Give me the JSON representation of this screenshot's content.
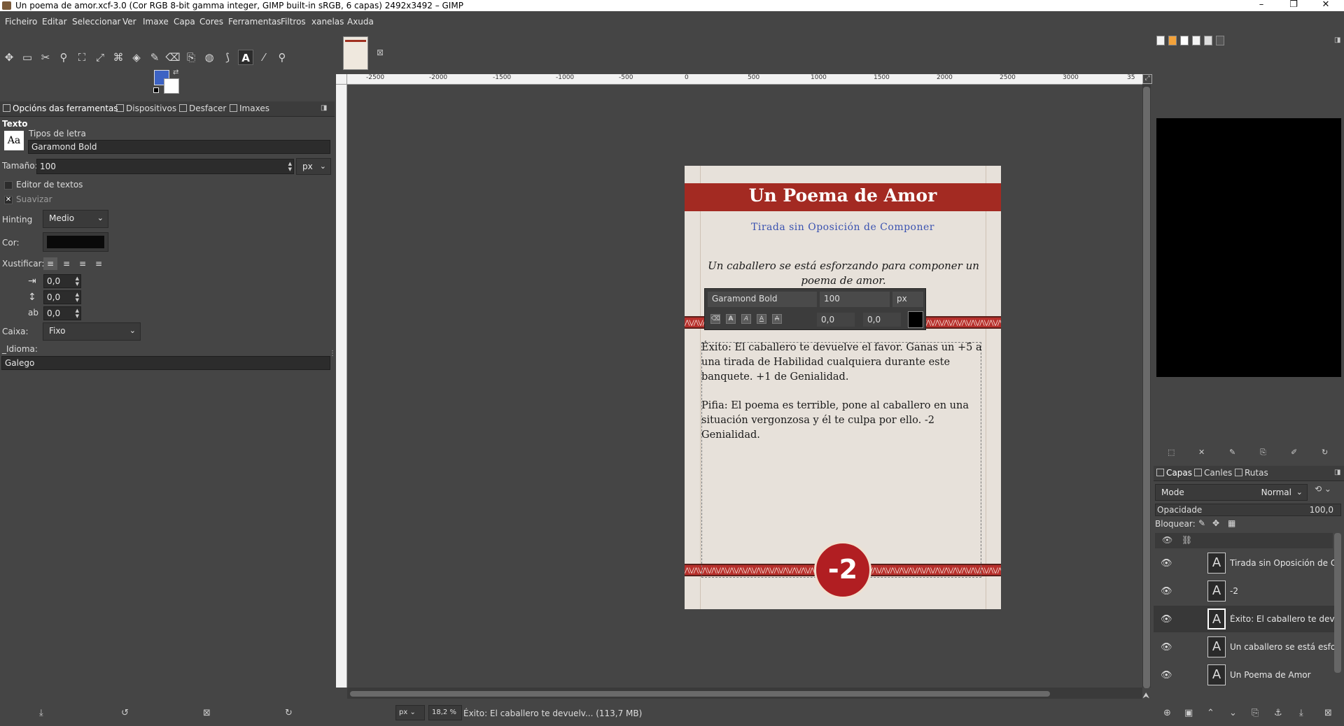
{
  "window": {
    "title": "Un poema de amor.xcf-3.0 (Cor RGB 8-bit gamma integer, GIMP built-in sRGB, 6 capas) 2492x3492 – GIMP",
    "minimize": "–",
    "maximize": "❐",
    "close": "✕"
  },
  "menu": [
    "Ficheiro",
    "Editar",
    "Seleccionar",
    "Ver",
    "Imaxe",
    "Capa",
    "Cores",
    "Ferramentas",
    "Filtros",
    "xanelas",
    "Axuda"
  ],
  "tools": [
    "move-icon",
    "rect-select-icon",
    "free-select-icon",
    "fuzzy-select-icon",
    "crop-icon",
    "unified-transform-icon",
    "warp-icon",
    "bucket-fill-icon",
    "paintbrush-icon",
    "eraser-icon",
    "clone-icon",
    "smudge-icon",
    "paths-icon",
    "text-icon",
    "color-picker-icon",
    "zoom-icon"
  ],
  "tool_glyphs": [
    "✥",
    "▭",
    "✂",
    "⚲",
    "⛶",
    "⤢",
    "⌘",
    "◈",
    "✎",
    "⌫",
    "⎘",
    "◍",
    "⟆",
    "A",
    "⁄",
    "⚲"
  ],
  "colors": {
    "foreground": "#3d63c4",
    "background": "#ffffff",
    "card_banner": "#a32a22",
    "subtitle": "#3a52b0"
  },
  "left_tabs": [
    "Opcións das ferramentas",
    "Dispositivos",
    "Desfacer",
    "Imaxes"
  ],
  "tool_options": {
    "title": "Texto",
    "font_label": "Tipos de letra",
    "font_value": "Garamond Bold",
    "size_label": "Tamaño:",
    "size_value": "100",
    "size_unit": "px",
    "editor_label": "Editor de textos",
    "antialias_label": "Suavizar",
    "hinting_label": "Hinting",
    "hinting_value": "Medio",
    "color_label": "Cor:",
    "justify_label": "Xustificar:",
    "indent_value": "0,0",
    "line_spacing_value": "0,0",
    "letter_spacing_value": "0,0",
    "box_label": "Caixa:",
    "box_value": "Fixo",
    "language_label": "_Idioma:",
    "language_value": "Galego"
  },
  "ruler_ticks": [
    "-2500",
    "-2000",
    "-1500",
    "-1000",
    "-500",
    "0",
    "500",
    "1000",
    "1500",
    "2000",
    "2500",
    "3000",
    "35"
  ],
  "card": {
    "title": "Un Poema de Amor",
    "subtitle": "Tirada sin Oposición de Componer",
    "intro": "Un caballero se está esforzando para componer un poema de amor.",
    "exito": "Éxito: El caballero te devuelve el favor. Ganas un +5 a una tirada de Habilidad cualquiera durante este banquete. +1 de Genialidad.",
    "pifia": "Pifia: El poema es terrible, pone al caballero en una situación vergonzosa y él te culpa por ello. -2 Genialidad.",
    "penalty": "-2"
  },
  "canvas_toolbar": {
    "font": "Garamond Bold",
    "size": "100",
    "unit": "px",
    "baseline": "0,0",
    "kerning": "0,0"
  },
  "layers_tabs": [
    "Capas",
    "Canles",
    "Rutas"
  ],
  "layers_panel": {
    "mode_label": "Mode",
    "mode_value": "Normal",
    "opacity_label": "Opacidade",
    "opacity_value": "100,0",
    "lock_label": "Bloquear:"
  },
  "layers": [
    {
      "name": "Tirada sin Oposición de C",
      "selected": false
    },
    {
      "name": "-2",
      "selected": false
    },
    {
      "name": "Éxito: El caballero te devu",
      "selected": true
    },
    {
      "name": "Un caballero se está esfo",
      "selected": false
    },
    {
      "name": "Un Poema de Amor",
      "selected": false
    }
  ],
  "status": {
    "unit": "px",
    "zoom": "18,2 %",
    "message": "Éxito: El caballero te devuelv... (113,7 MB)"
  }
}
